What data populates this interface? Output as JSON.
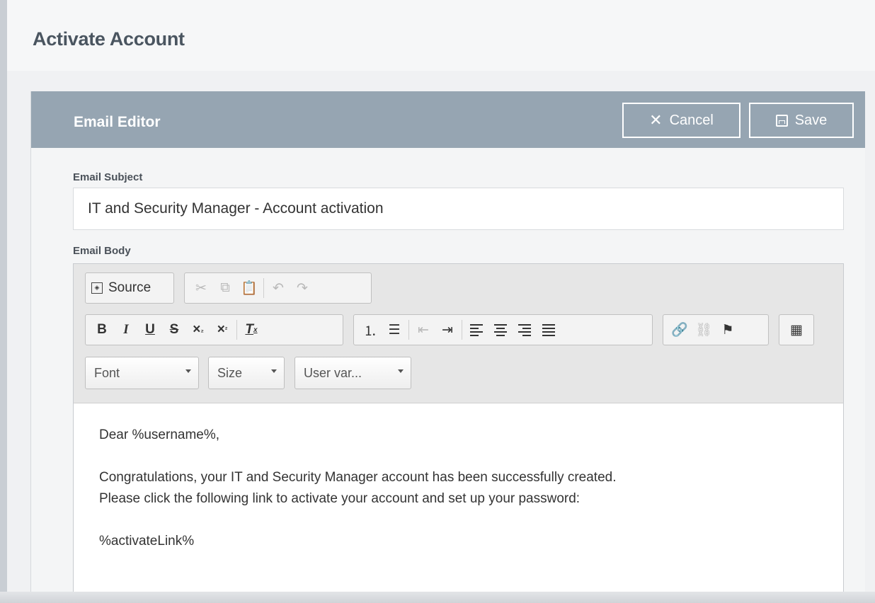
{
  "page": {
    "title": "Activate Account"
  },
  "panel": {
    "title": "Email Editor",
    "cancel_label": "Cancel",
    "save_label": "Save"
  },
  "subject": {
    "label": "Email Subject",
    "value": "IT and Security Manager - Account activation"
  },
  "body": {
    "label": "Email Body",
    "toolbar": {
      "source_label": "Source",
      "font_label": "Font",
      "size_label": "Size",
      "uservar_label": "User var..."
    },
    "lines": [
      "Dear %username%,",
      "",
      "Congratulations, your IT and Security Manager account has been successfully created.",
      "Please click the following link to activate your account and set up your password:",
      "",
      "%activateLink%"
    ]
  }
}
